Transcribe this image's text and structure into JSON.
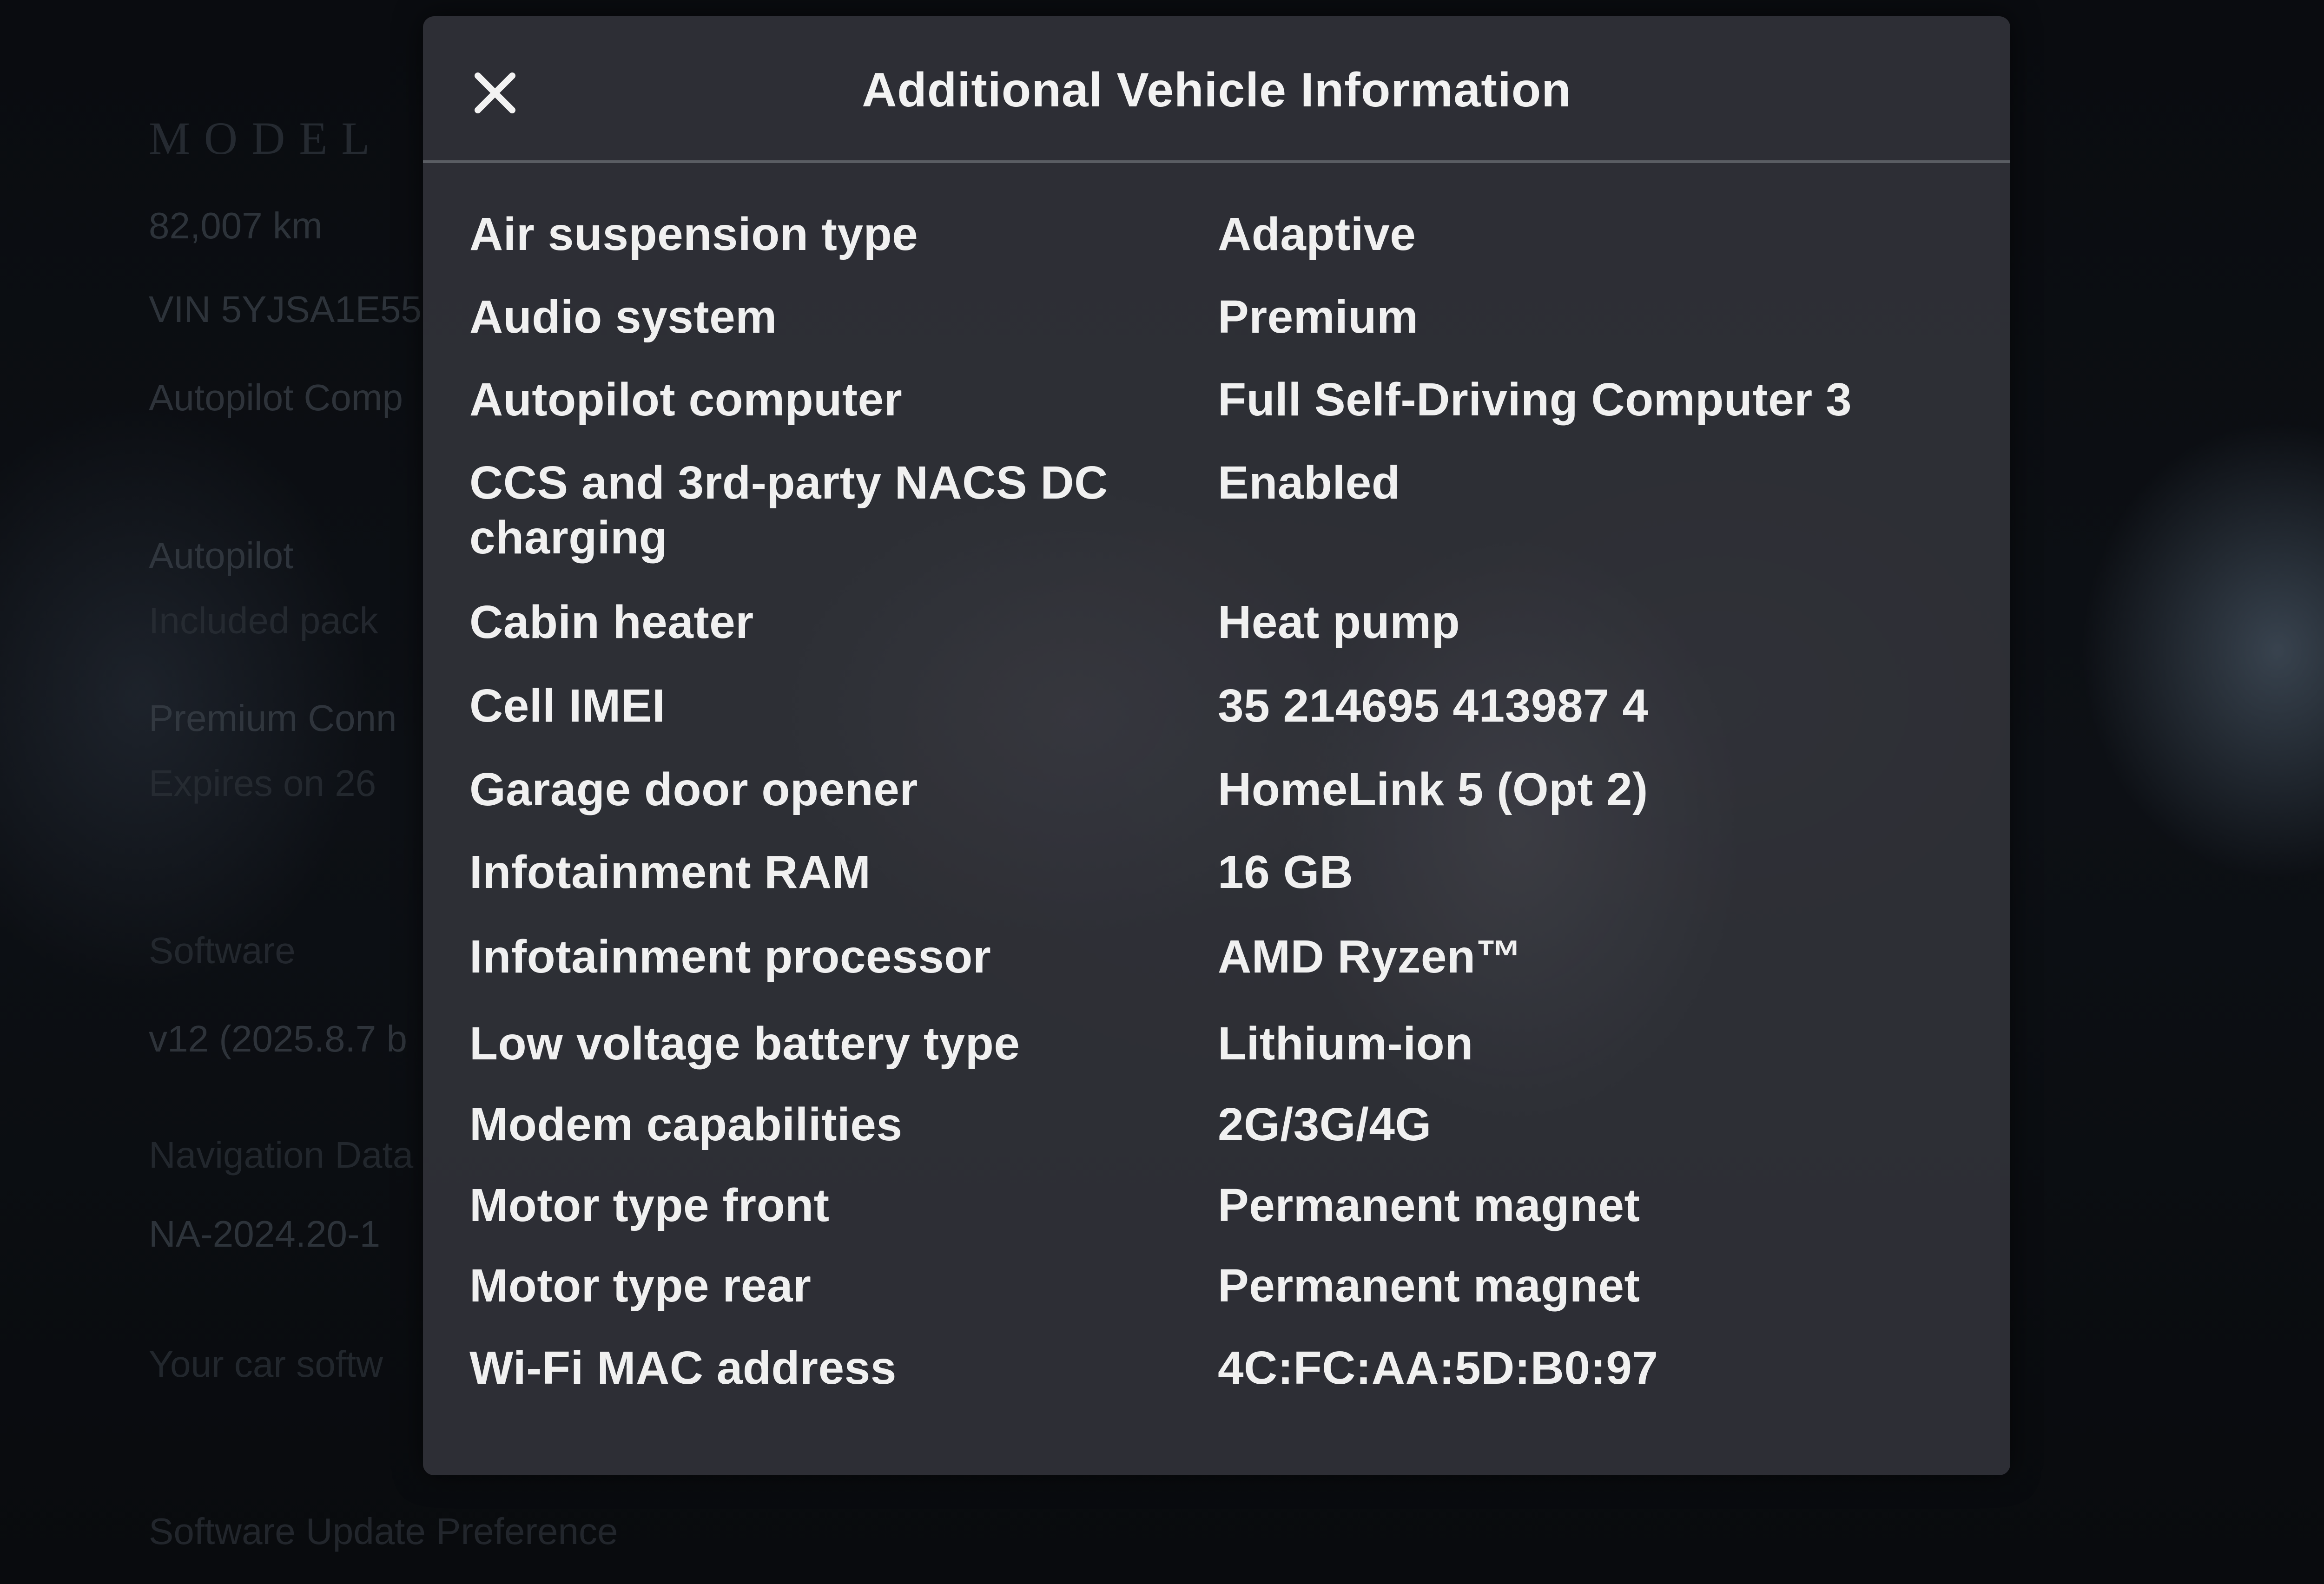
{
  "background": {
    "model_text": "MODEL",
    "odometer": "82,007 km",
    "vin": "VIN 5YJSA1E55",
    "autopilot_computer": "Autopilot Comp",
    "autopilot": "Autopilot",
    "included_package": "Included pack",
    "premium_connectivity": "Premium Conn",
    "expires": "Expires on 26",
    "software": "Software",
    "software_version": "v12 (2025.8.7 b",
    "navigation_data": "Navigation Data",
    "navigation_version": "NA-2024.20-1",
    "your_car_software": "Your car softw",
    "software_update_preference": "Software Update Preference"
  },
  "modal": {
    "title": "Additional Vehicle Information",
    "close_icon": "close-icon",
    "rows": [
      {
        "label": "Air suspension type",
        "value": "Adaptive"
      },
      {
        "label": "Audio system",
        "value": "Premium"
      },
      {
        "label": "Autopilot computer",
        "value": "Full Self-Driving Computer 3"
      },
      {
        "label": "CCS and 3rd-party NACS DC charging",
        "value": "Enabled"
      },
      {
        "label": "Cabin heater",
        "value": "Heat pump"
      },
      {
        "label": "Cell IMEI",
        "value": "35 214695 413987 4"
      },
      {
        "label": "Garage door opener",
        "value": "HomeLink 5 (Opt 2)"
      },
      {
        "label": "Infotainment RAM",
        "value": "16 GB"
      },
      {
        "label": "Infotainment processor",
        "value": "AMD Ryzen™"
      },
      {
        "label": "Low voltage battery type",
        "value": "Lithium-ion"
      },
      {
        "label": "Modem capabilities",
        "value": "2G/3G/4G"
      },
      {
        "label": "Motor type front",
        "value": "Permanent magnet"
      },
      {
        "label": "Motor type rear",
        "value": "Permanent magnet"
      },
      {
        "label": "Wi-Fi MAC address",
        "value": "4C:FC:AA:5D:B0:97"
      }
    ]
  }
}
